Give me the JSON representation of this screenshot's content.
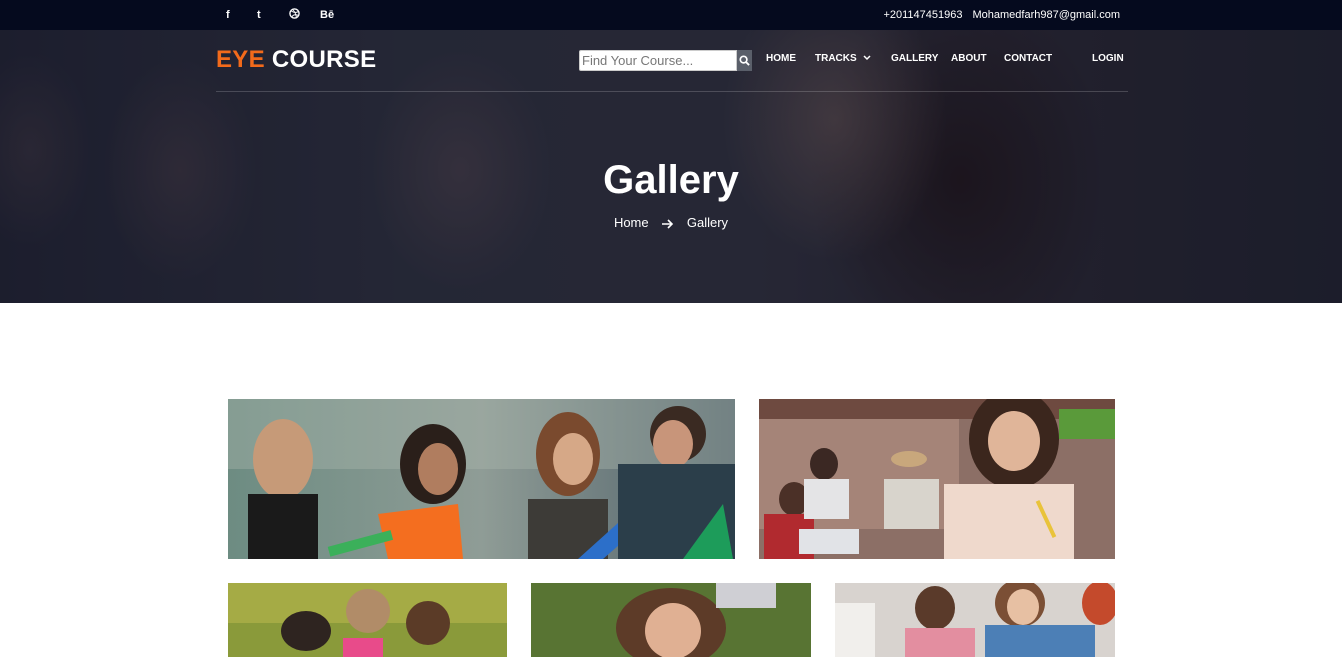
{
  "topbar": {
    "social": [
      "f",
      "t",
      "d",
      "Bē"
    ],
    "phone": "+201147451963",
    "email": "Mohamedfarh987@gmail.com"
  },
  "header": {
    "logo_part1": "EYE",
    "logo_part2": "COURSE",
    "search_placeholder": "Find Your Course...",
    "nav": {
      "home": "HOME",
      "tracks": "TRACKS",
      "gallery": "GALLERY",
      "about": "ABOUT",
      "contact": "CONTACT",
      "login": "LOGIN"
    }
  },
  "hero": {
    "title": "Gallery",
    "breadcrumb": [
      "Home",
      "Gallery"
    ]
  },
  "colors": {
    "accent": "#f26a1b",
    "topbar": "#050a1e"
  }
}
